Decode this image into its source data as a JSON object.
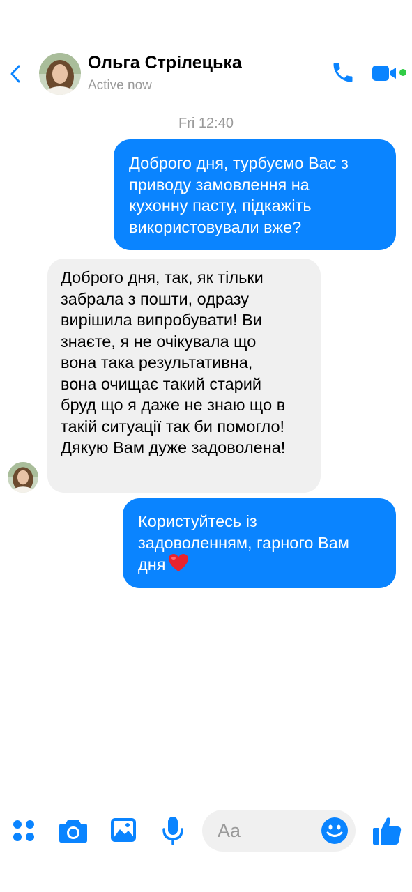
{
  "header": {
    "name": "Ольга Стрілецька",
    "status": "Active now",
    "icons": {
      "back": "chevron-left-icon",
      "call": "phone-icon",
      "video": "video-camera-icon"
    }
  },
  "conversation": {
    "timestamp": "Fri 12:40",
    "messages": [
      {
        "direction": "outgoing",
        "text": "Доброго дня, турбуємо Вас з\nприводу замовлення на\nкухонну пасту, підкажіть\nвикористовували вже?"
      },
      {
        "direction": "incoming",
        "text": "Доброго дня, так, як тільки\nзабрала з пошти, одразу\nвирішила випробувати! Ви\nзнаєте, я не очікувала що\nвона така результативна,\nвона очищає такий старий\nбруд що я даже не знаю що в\nтакій ситуації так би помогло!\nДякую Вам дуже задоволена!"
      },
      {
        "direction": "outgoing",
        "text": "Користуйтесь із\nзадоволенням, гарного Вам\nдня",
        "emoji": "heart-emoji"
      }
    ]
  },
  "composer": {
    "placeholder": "Aa",
    "icons": [
      "apps-icon",
      "camera-icon",
      "image-icon",
      "microphone-icon",
      "emoji-icon",
      "thumbs-up-icon"
    ]
  },
  "colors": {
    "accent": "#0a84ff",
    "outgoing_bubble": "#0a84ff",
    "incoming_bubble": "#f0f0f0",
    "online": "#31cc46",
    "muted_text": "#9a9a9a"
  }
}
